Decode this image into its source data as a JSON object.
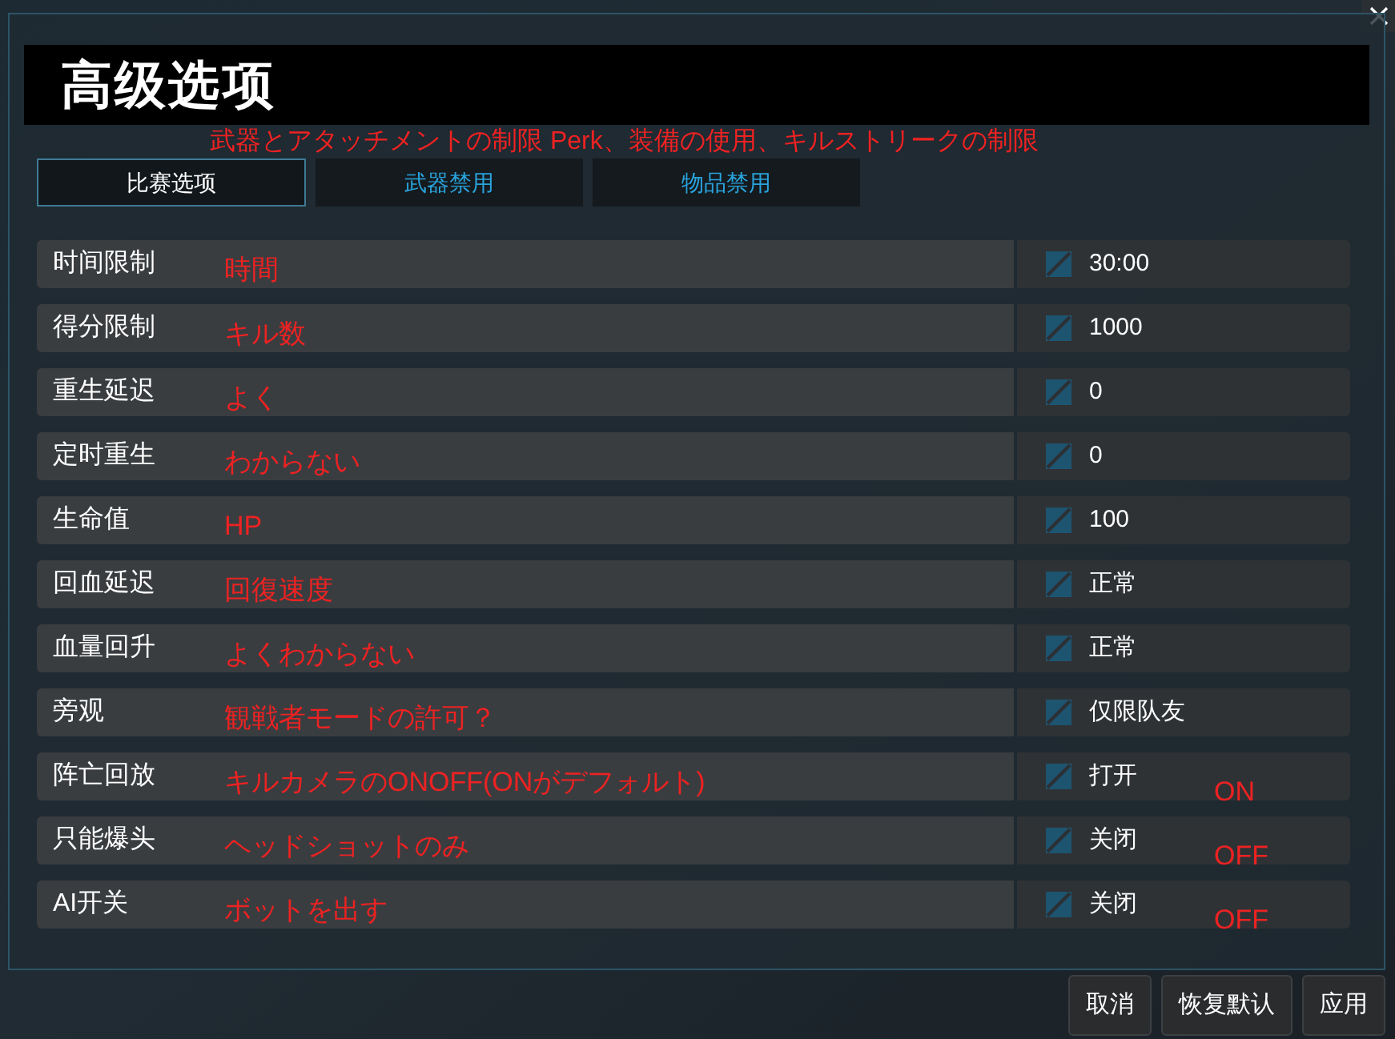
{
  "dialog": {
    "title": "高级选项",
    "note": "武器とアタッチメントの制限 Perk、装備の使用、キルストリークの制限"
  },
  "tabs": [
    {
      "label": "比赛选项",
      "selected": true
    },
    {
      "label": "武器禁用",
      "selected": false
    },
    {
      "label": "物品禁用",
      "selected": false
    }
  ],
  "options": [
    {
      "label": "时间限制",
      "note": "時間",
      "value": "30:00"
    },
    {
      "label": "得分限制",
      "note": "キル数",
      "value": "1000"
    },
    {
      "label": "重生延迟",
      "note": "よく",
      "value": "0"
    },
    {
      "label": "定时重生",
      "note": "わからない",
      "value": "0"
    },
    {
      "label": "生命值",
      "note": "HP",
      "value": "100"
    },
    {
      "label": "回血延迟",
      "note": "回復速度",
      "value": "正常"
    },
    {
      "label": "血量回升",
      "note": "よくわからない",
      "value": "正常"
    },
    {
      "label": "旁观",
      "note": "観戦者モードの許可？",
      "value": "仅限队友"
    },
    {
      "label": "阵亡回放",
      "note": "キルカメラのONOFF(ONがデフォルト)",
      "value": "打开",
      "side_note": "ON"
    },
    {
      "label": "只能爆头",
      "note": "ヘッドショットのみ",
      "value": "关闭",
      "side_note": "OFF"
    },
    {
      "label": "AI开关",
      "note": "ボットを出す",
      "value": "关闭",
      "side_note": "OFF"
    }
  ],
  "buttons": [
    "取消",
    "恢复默认",
    "应用"
  ]
}
